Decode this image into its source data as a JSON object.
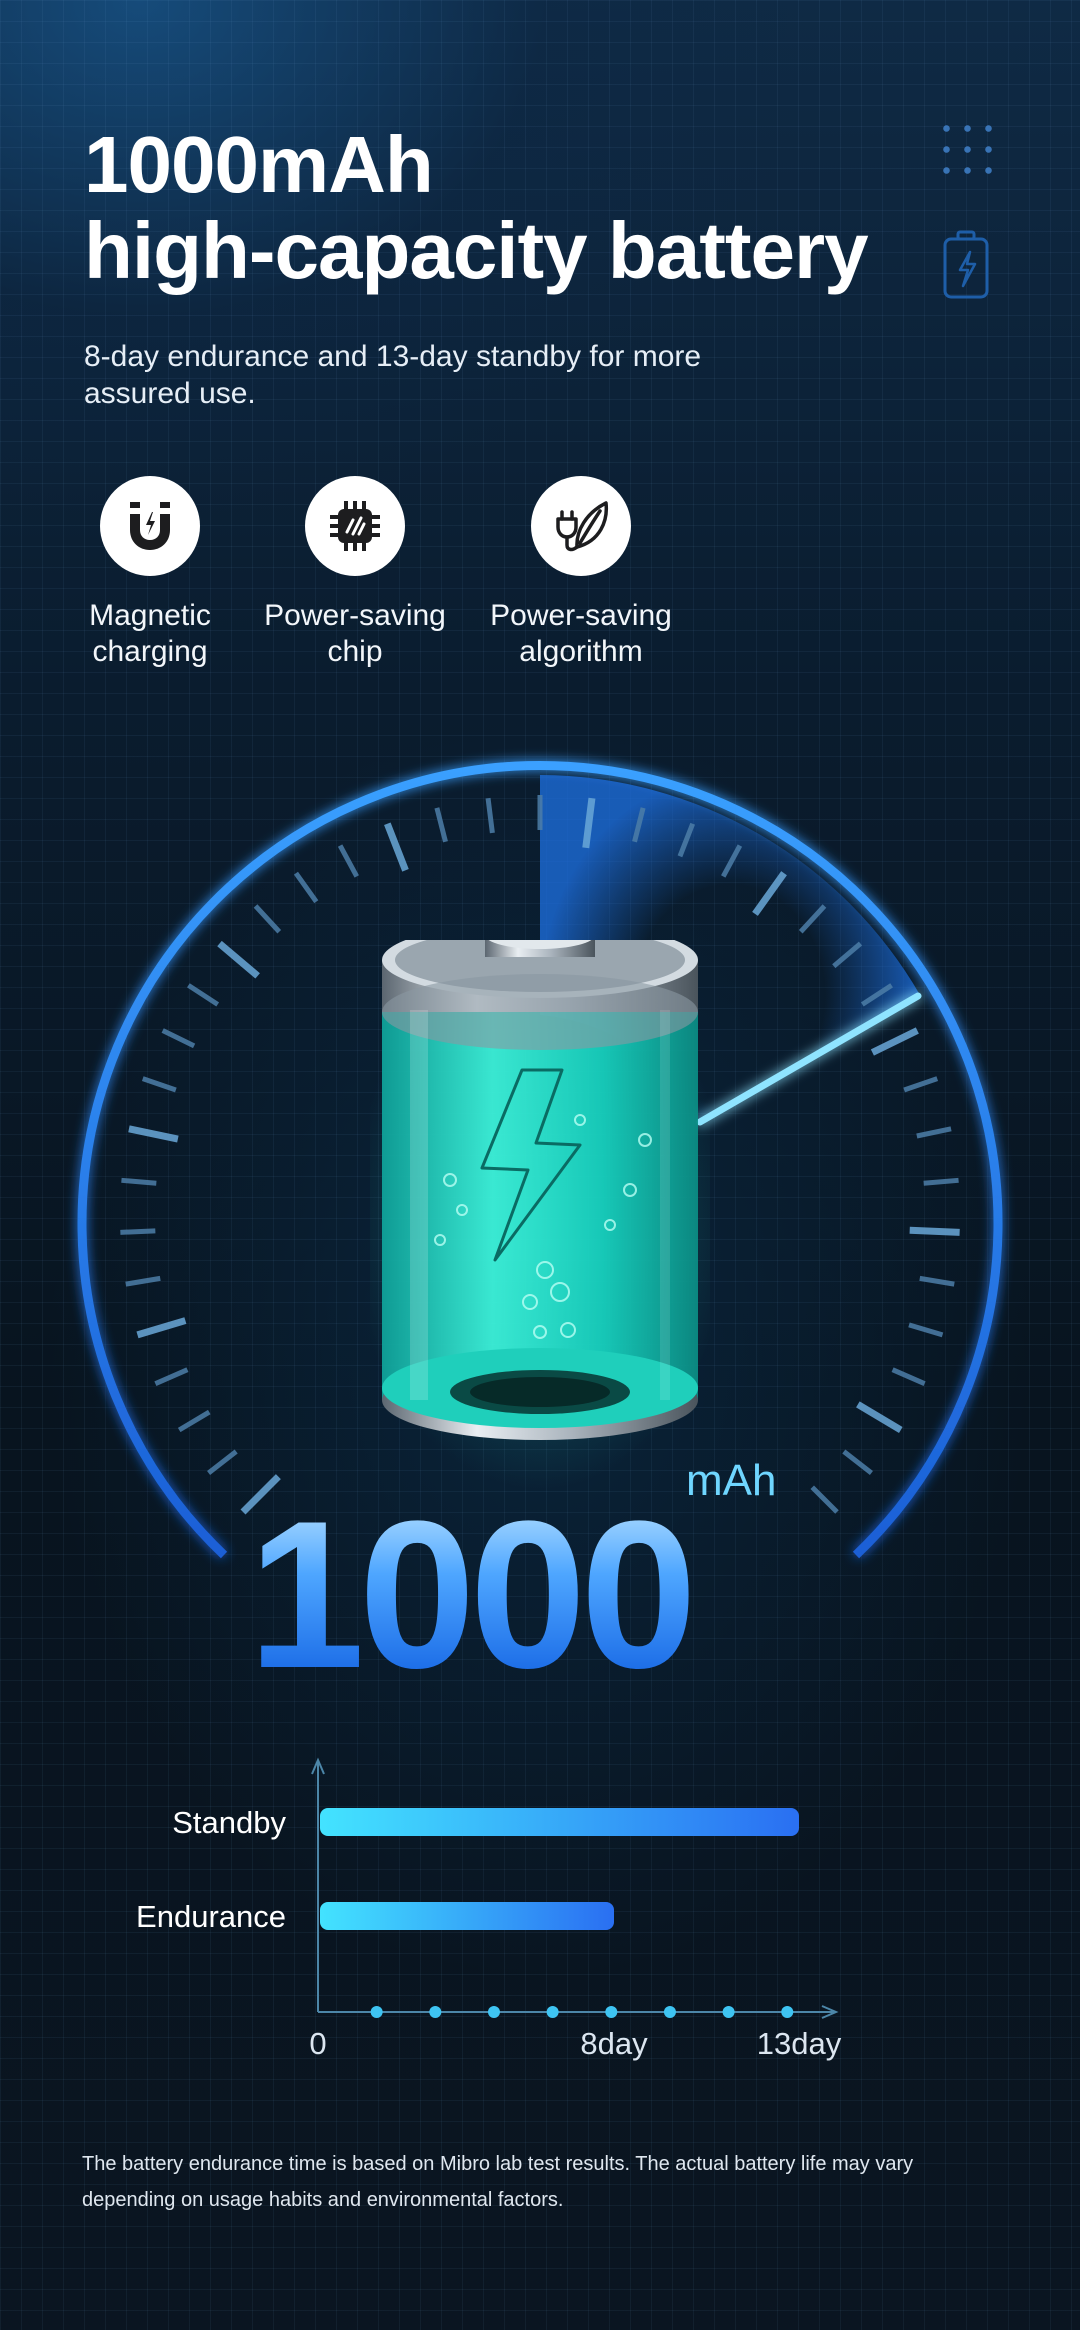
{
  "header": {
    "title_line1": "1000mAh",
    "title_line2": "high-capacity battery",
    "subtitle": "8-day endurance and 13-day standby for more assured use."
  },
  "features": [
    {
      "label": "Magnetic\ncharging",
      "icon": "magnet-icon"
    },
    {
      "label": "Power-saving\nchip",
      "icon": "chip-icon"
    },
    {
      "label": "Power-saving\nalgorithm",
      "icon": "plug-leaf-icon"
    }
  ],
  "capacity": {
    "value": "1000",
    "unit": "mAh"
  },
  "chart_data": {
    "type": "bar",
    "orientation": "horizontal",
    "categories": [
      "Standby",
      "Endurance"
    ],
    "values": [
      13,
      8
    ],
    "xlim": [
      0,
      14
    ],
    "x_ticks": [
      "0",
      "8day",
      "13day"
    ],
    "x_tick_values": [
      0,
      8,
      13
    ],
    "colors": {
      "bar_start": "#43e3ff",
      "bar_end": "#2a6ff2",
      "axis": "#4c86a8",
      "dot": "#3ec4f2"
    }
  },
  "footnote": "The battery endurance time is based on Mibro lab test results. The actual battery life may vary depending on usage habits and environmental factors.",
  "colors": {
    "accent": "#2f8dff",
    "battery_liquid": "#19d9c2",
    "unit_text": "#6fd6ff"
  }
}
